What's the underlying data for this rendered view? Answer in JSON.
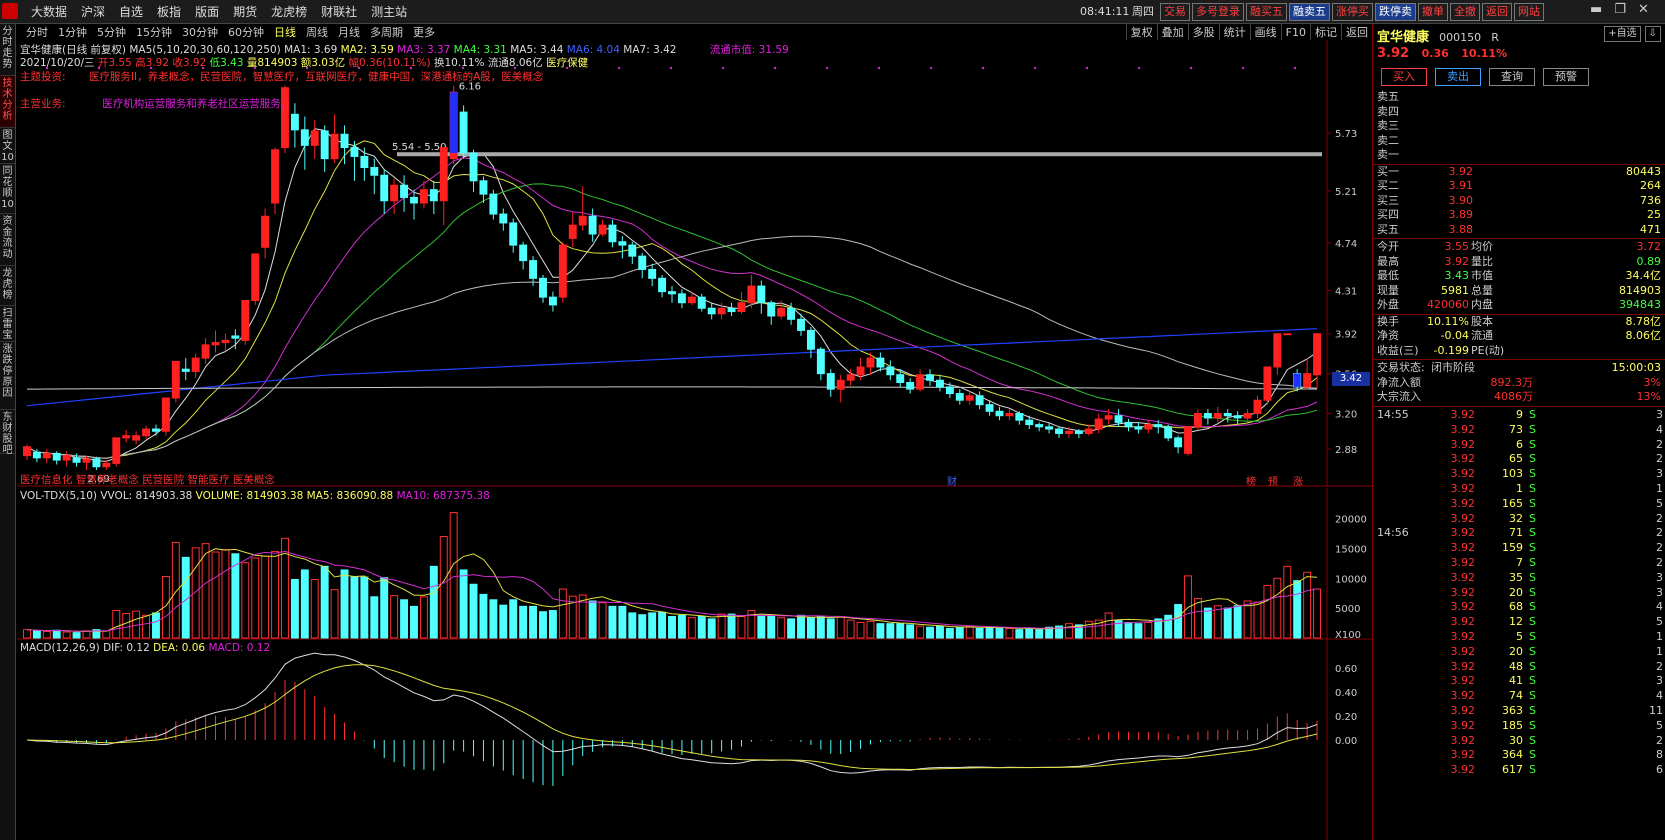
{
  "menu": [
    "大数据",
    "沪深",
    "自选",
    "板指",
    "版面",
    "期货",
    "龙虎榜",
    "财联社",
    "测主站"
  ],
  "clock": "08:41:11",
  "weekday": "周四",
  "topbtns": [
    "交易",
    "多号登录",
    "融买五",
    "融卖五",
    "涨停买",
    "跌停卖",
    "撤单",
    "全撤",
    "返回",
    "网站"
  ],
  "left_tabs": [
    "分时走势",
    "技术分析",
    "图文10",
    "同花顺10",
    "资金流动",
    "龙虎榜",
    "扫雷宝",
    "涨跌停原因",
    "东财股吧"
  ],
  "periods": [
    "分时",
    "1分钟",
    "5分钟",
    "15分钟",
    "30分钟",
    "60分钟",
    "日线",
    "周线",
    "月线",
    "多周期",
    "更多"
  ],
  "active_period": "日线",
  "rtools": [
    "复权",
    "叠加",
    "多股",
    "统计",
    "画线",
    "F10",
    "标记",
    "返回"
  ],
  "ma_legend": {
    "name": "宜华健康(日线 前复权)",
    "params": "MA5(5,10,20,30,60,120,250)",
    "ma1": "MA1: 3.69",
    "ma2": "MA2: 3.59",
    "ma3": "MA3: 3.37",
    "ma4": "MA4: 3.31",
    "ma5": "MA5: 3.44",
    "ma6": "MA6: 4.04",
    "ma7": "MA7: 3.42",
    "float_cap": "流通市值: 31.59"
  },
  "info_line": {
    "date": "2021/10/20/三",
    "open": "开3.55",
    "high": "高3.92",
    "close": "收3.92",
    "low": "低3.43",
    "vol": "量814903",
    "amt": "额3.03亿",
    "chg": "幅0.36(10.11%)",
    "turn": "换10.11%",
    "float": "流通8.06亿",
    "sector": "医疗保健"
  },
  "tags": {
    "label": "主题投资:",
    "text": "医疗服务II，养老概念，民营医院，智慧医疗，互联网医疗，健康中国，深港通标的A股，医美概念"
  },
  "biz": {
    "label": "主营业务:",
    "text": "医疗机构运营服务和养老社区运营服务。"
  },
  "bottom_tags": "医疗信息化 智慧养老概念 民营医院 智能医疗 医美概念",
  "annotations": {
    "max_label": "6.16",
    "min_label": "2.69",
    "range_label": "5.54 - 5.50",
    "markers": [
      "财",
      "榜",
      "预",
      "涨"
    ]
  },
  "y_axis": [
    "5.73",
    "5.21",
    "4.74",
    "4.31",
    "3.92",
    "3.56",
    "3.20",
    "2.88"
  ],
  "vol_y_axis": [
    "20000",
    "15000",
    "10000",
    "5000",
    "X100"
  ],
  "macd_y_axis": [
    "0.60",
    "0.40",
    "0.20",
    "0.00"
  ],
  "current_price_label": "3.42",
  "vol_legend": {
    "name": "VOL-TDX(5,10)",
    "vvol": "VVOL: 814903.38",
    "volume": "VOLUME: 814903.38",
    "ma5": "MA5: 836090.88",
    "ma10": "MA10: 687375.38"
  },
  "macd_legend": {
    "name": "MACD(12,26,9)",
    "dif": "DIF: 0.12",
    "dea": "DEA: 0.06",
    "macd": "MACD: 0.12"
  },
  "chart_data": {
    "type": "candlestick",
    "title": "宜华健康(日线 前复权)",
    "ylim": [
      2.6,
      6.3
    ],
    "candles": [
      [
        2.82,
        2.9,
        2.78,
        2.92
      ],
      [
        2.85,
        2.8,
        2.76,
        2.88
      ],
      [
        2.8,
        2.84,
        2.75,
        2.88
      ],
      [
        2.84,
        2.78,
        2.74,
        2.86
      ],
      [
        2.78,
        2.82,
        2.72,
        2.86
      ],
      [
        2.8,
        2.76,
        2.72,
        2.84
      ],
      [
        2.76,
        2.79,
        2.69,
        2.82
      ],
      [
        2.79,
        2.72,
        2.69,
        2.81
      ],
      [
        2.72,
        2.75,
        2.69,
        2.78
      ],
      [
        2.75,
        2.98,
        2.72,
        2.98
      ],
      [
        2.98,
        3.0,
        2.94,
        3.05
      ],
      [
        2.96,
        3.0,
        2.92,
        3.04
      ],
      [
        3.0,
        3.06,
        2.97,
        3.09
      ],
      [
        3.06,
        3.04,
        3.0,
        3.1
      ],
      [
        3.04,
        3.34,
        3.0,
        3.34
      ],
      [
        3.34,
        3.67,
        3.3,
        3.67
      ],
      [
        3.6,
        3.58,
        3.5,
        3.7
      ],
      [
        3.58,
        3.7,
        3.52,
        3.74
      ],
      [
        3.7,
        3.82,
        3.65,
        3.88
      ],
      [
        3.82,
        3.84,
        3.75,
        3.95
      ],
      [
        3.84,
        3.86,
        3.76,
        3.92
      ],
      [
        3.9,
        3.88,
        3.78,
        3.96
      ],
      [
        3.86,
        4.22,
        3.82,
        4.22
      ],
      [
        4.22,
        4.64,
        4.18,
        4.64
      ],
      [
        4.7,
        4.98,
        4.6,
        5.05
      ],
      [
        5.1,
        5.58,
        5.0,
        5.6
      ],
      [
        5.6,
        6.14,
        5.55,
        6.16
      ],
      [
        5.9,
        5.76,
        5.6,
        6.0
      ],
      [
        5.76,
        5.62,
        5.4,
        5.88
      ],
      [
        5.62,
        5.75,
        5.5,
        5.85
      ],
      [
        5.75,
        5.5,
        5.38,
        5.8
      ],
      [
        5.5,
        5.72,
        5.46,
        5.9
      ],
      [
        5.72,
        5.6,
        5.45,
        5.8
      ],
      [
        5.6,
        5.52,
        5.3,
        5.66
      ],
      [
        5.52,
        5.42,
        5.3,
        5.6
      ],
      [
        5.42,
        5.35,
        5.18,
        5.5
      ],
      [
        5.35,
        5.12,
        5.0,
        5.4
      ],
      [
        5.12,
        5.26,
        5.0,
        5.32
      ],
      [
        5.26,
        5.15,
        5.02,
        5.35
      ],
      [
        5.15,
        5.1,
        4.95,
        5.22
      ],
      [
        5.1,
        5.22,
        5.05,
        5.3
      ],
      [
        5.22,
        5.12,
        5.0,
        5.3
      ],
      [
        5.12,
        5.6,
        4.9,
        5.6
      ],
      [
        5.5,
        6.1,
        5.45,
        6.16
      ],
      [
        5.92,
        5.55,
        5.5,
        5.98
      ],
      [
        5.55,
        5.3,
        5.2,
        5.58
      ],
      [
        5.3,
        5.18,
        5.1,
        5.34
      ],
      [
        5.18,
        5.0,
        4.95,
        5.22
      ],
      [
        5.0,
        4.92,
        4.85,
        5.05
      ],
      [
        4.92,
        4.72,
        4.65,
        4.96
      ],
      [
        4.72,
        4.58,
        4.5,
        4.75
      ],
      [
        4.58,
        4.42,
        4.35,
        4.62
      ],
      [
        4.42,
        4.25,
        4.2,
        4.45
      ],
      [
        4.25,
        4.18,
        4.12,
        4.3
      ],
      [
        4.25,
        4.72,
        4.2,
        4.75
      ],
      [
        4.78,
        4.9,
        4.7,
        5.02
      ],
      [
        4.9,
        4.98,
        4.85,
        5.25
      ],
      [
        4.98,
        4.82,
        4.75,
        5.05
      ],
      [
        4.82,
        4.9,
        4.8,
        4.95
      ],
      [
        4.9,
        4.75,
        4.7,
        4.95
      ],
      [
        4.75,
        4.72,
        4.6,
        4.8
      ],
      [
        4.72,
        4.62,
        4.55,
        4.75
      ],
      [
        4.62,
        4.5,
        4.42,
        4.65
      ],
      [
        4.5,
        4.42,
        4.35,
        4.55
      ],
      [
        4.42,
        4.3,
        4.25,
        4.45
      ],
      [
        4.3,
        4.28,
        4.2,
        4.35
      ],
      [
        4.28,
        4.2,
        4.15,
        4.32
      ],
      [
        4.2,
        4.25,
        4.18,
        4.3
      ],
      [
        4.25,
        4.15,
        4.12,
        4.28
      ],
      [
        4.15,
        4.1,
        4.05,
        4.2
      ],
      [
        4.1,
        4.15,
        4.05,
        4.2
      ],
      [
        4.15,
        4.12,
        4.08,
        4.2
      ],
      [
        4.12,
        4.2,
        4.1,
        4.3
      ],
      [
        4.2,
        4.35,
        4.15,
        4.45
      ],
      [
        4.35,
        4.2,
        4.1,
        4.4
      ],
      [
        4.2,
        4.08,
        4.0,
        4.22
      ],
      [
        4.08,
        4.15,
        4.05,
        4.22
      ],
      [
        4.15,
        4.05,
        4.0,
        4.2
      ],
      [
        4.05,
        3.95,
        3.9,
        4.1
      ],
      [
        3.95,
        3.78,
        3.7,
        3.98
      ],
      [
        3.78,
        3.56,
        3.5,
        3.8
      ],
      [
        3.56,
        3.42,
        3.35,
        3.6
      ],
      [
        3.42,
        3.5,
        3.3,
        3.55
      ],
      [
        3.5,
        3.55,
        3.45,
        3.6
      ],
      [
        3.55,
        3.62,
        3.5,
        3.7
      ],
      [
        3.62,
        3.7,
        3.55,
        3.75
      ],
      [
        3.7,
        3.62,
        3.58,
        3.75
      ],
      [
        3.62,
        3.55,
        3.5,
        3.68
      ],
      [
        3.55,
        3.48,
        3.44,
        3.6
      ],
      [
        3.48,
        3.42,
        3.38,
        3.52
      ],
      [
        3.42,
        3.55,
        3.4,
        3.6
      ],
      [
        3.55,
        3.5,
        3.45,
        3.6
      ],
      [
        3.5,
        3.44,
        3.4,
        3.55
      ],
      [
        3.44,
        3.38,
        3.34,
        3.48
      ],
      [
        3.38,
        3.32,
        3.28,
        3.42
      ],
      [
        3.32,
        3.36,
        3.28,
        3.4
      ],
      [
        3.36,
        3.28,
        3.24,
        3.4
      ],
      [
        3.28,
        3.22,
        3.18,
        3.32
      ],
      [
        3.22,
        3.18,
        3.14,
        3.26
      ],
      [
        3.18,
        3.2,
        3.14,
        3.24
      ],
      [
        3.2,
        3.14,
        3.1,
        3.22
      ],
      [
        3.14,
        3.1,
        3.06,
        3.18
      ],
      [
        3.1,
        3.08,
        3.04,
        3.12
      ],
      [
        3.08,
        3.06,
        3.02,
        3.12
      ],
      [
        3.06,
        3.02,
        2.98,
        3.08
      ],
      [
        3.02,
        3.04,
        2.98,
        3.08
      ],
      [
        3.04,
        3.02,
        2.98,
        3.06
      ],
      [
        3.02,
        3.06,
        3.0,
        3.1
      ],
      [
        3.06,
        3.15,
        3.02,
        3.2
      ],
      [
        3.15,
        3.18,
        3.1,
        3.24
      ],
      [
        3.18,
        3.12,
        3.08,
        3.24
      ],
      [
        3.12,
        3.08,
        3.04,
        3.15
      ],
      [
        3.08,
        3.06,
        3.02,
        3.12
      ],
      [
        3.06,
        3.1,
        3.02,
        3.14
      ],
      [
        3.1,
        3.08,
        3.02,
        3.14
      ],
      [
        3.08,
        2.98,
        2.95,
        3.1
      ],
      [
        2.98,
        2.9,
        2.84,
        3.0
      ],
      [
        2.84,
        3.08,
        2.82,
        3.08
      ],
      [
        3.08,
        3.2,
        3.05,
        3.24
      ],
      [
        3.2,
        3.16,
        3.1,
        3.24
      ],
      [
        3.16,
        3.2,
        3.12,
        3.26
      ],
      [
        3.2,
        3.18,
        3.12,
        3.24
      ],
      [
        3.18,
        3.16,
        3.1,
        3.22
      ],
      [
        3.16,
        3.2,
        3.12,
        3.24
      ],
      [
        3.2,
        3.32,
        3.16,
        3.36
      ],
      [
        3.32,
        3.62,
        3.28,
        3.62
      ],
      [
        3.62,
        3.92,
        3.55,
        3.92
      ],
      [
        3.92,
        3.92,
        3.92,
        3.92
      ],
      [
        3.56,
        3.44,
        3.4,
        3.6
      ],
      [
        3.44,
        3.56,
        3.42,
        3.7
      ],
      [
        3.55,
        3.92,
        3.43,
        3.92
      ]
    ],
    "volume": [
      14,
      12,
      11,
      13,
      10,
      9,
      12,
      14,
      12,
      46,
      41,
      45,
      38,
      42,
      103,
      160,
      135,
      151,
      158,
      144,
      148,
      141,
      126,
      134,
      137,
      145,
      167,
      98,
      114,
      98,
      120,
      81,
      114,
      102,
      102,
      69,
      101,
      71,
      64,
      53,
      69,
      120,
      170,
      210,
      114,
      90,
      73,
      64,
      55,
      64,
      53,
      53,
      44,
      46,
      82,
      70,
      72,
      62,
      59,
      53,
      53,
      42,
      39,
      42,
      43,
      36,
      38,
      34,
      36,
      32,
      40,
      40,
      36,
      46,
      38,
      36,
      34,
      32,
      38,
      34,
      36,
      32,
      36,
      30,
      26,
      28,
      24,
      24,
      24,
      22,
      20,
      18,
      20,
      16,
      18,
      20,
      16,
      18,
      16,
      16,
      14,
      16,
      14,
      18,
      20,
      24,
      22,
      28,
      30,
      42,
      30,
      26,
      24,
      26,
      32,
      38,
      56,
      104,
      66,
      50,
      54,
      50,
      54,
      62,
      60,
      88,
      100,
      120,
      96,
      110,
      82
    ],
    "macd": {
      "dif_peak": 0.66,
      "dea_peak": 0.62,
      "last_dif": 0.12,
      "last_dea": 0.06,
      "last_macd": 0.12
    }
  },
  "right_panel": {
    "name": "宜华健康",
    "code": "000150",
    "suffix": "R",
    "btns": [
      "+自选",
      "⇩"
    ],
    "price": "3.92",
    "change": "0.36",
    "pct": "10.11%",
    "actions": [
      "买入",
      "卖出",
      "查询",
      "预警"
    ],
    "asks": [
      {
        "l": "卖五",
        "p": "",
        "v": ""
      },
      {
        "l": "卖四",
        "p": "",
        "v": ""
      },
      {
        "l": "卖三",
        "p": "",
        "v": ""
      },
      {
        "l": "卖二",
        "p": "",
        "v": ""
      },
      {
        "l": "卖一",
        "p": "",
        "v": ""
      }
    ],
    "bids": [
      {
        "l": "买一",
        "p": "3.92",
        "v": "80443"
      },
      {
        "l": "买二",
        "p": "3.91",
        "v": "264"
      },
      {
        "l": "买三",
        "p": "3.90",
        "v": "736"
      },
      {
        "l": "买四",
        "p": "3.89",
        "v": "25"
      },
      {
        "l": "买五",
        "p": "3.88",
        "v": "471"
      }
    ],
    "stats": [
      {
        "l1": "今开",
        "v1": "3.55",
        "l2": "均价",
        "v2": "3.72",
        "c1": "#ff3030",
        "c2": "#ff3030"
      },
      {
        "l1": "最高",
        "v1": "3.92",
        "l2": "量比",
        "v2": "0.89",
        "c1": "#ff3030",
        "c2": "#40ff40"
      },
      {
        "l1": "最低",
        "v1": "3.43",
        "l2": "市值",
        "v2": "34.4亿",
        "c1": "#40ff40",
        "c2": "#ffff60"
      },
      {
        "l1": "现量",
        "v1": "5981",
        "l2": "总量",
        "v2": "814903",
        "c1": "#ffff60",
        "c2": "#ffff60"
      },
      {
        "l1": "外盘",
        "v1": "420060",
        "l2": "内盘",
        "v2": "394843",
        "c1": "#ff3030",
        "c2": "#40ff40"
      },
      {
        "l1": "换手",
        "v1": "10.11%",
        "l2": "股本",
        "v2": "8.78亿",
        "c1": "#ffff60",
        "c2": "#ffff60"
      },
      {
        "l1": "净资",
        "v1": "-0.04",
        "l2": "流通",
        "v2": "8.06亿",
        "c1": "#ffff60",
        "c2": "#ffff60"
      },
      {
        "l1": "收益(三)",
        "v1": "-0.199",
        "l2": "PE(动)",
        "v2": "",
        "c1": "#ffff60",
        "c2": "#ffff60"
      }
    ],
    "trade_status_label": "交易状态:",
    "trade_status": "闭市阶段",
    "trade_time": "15:00:03",
    "net_inflow_label": "净流入额",
    "net_inflow": "892.3万",
    "net_inflow_pct": "3%",
    "block_label": "大宗流入",
    "block_inflow": "4086万",
    "block_pct": "13%",
    "ticks": [
      {
        "t": "14:55",
        "p": "3.92",
        "v": "9",
        "s": "S",
        "n": "3"
      },
      {
        "t": "",
        "p": "3.92",
        "v": "73",
        "s": "S",
        "n": "4"
      },
      {
        "t": "",
        "p": "3.92",
        "v": "6",
        "s": "S",
        "n": "2"
      },
      {
        "t": "",
        "p": "3.92",
        "v": "65",
        "s": "S",
        "n": "2"
      },
      {
        "t": "",
        "p": "3.92",
        "v": "103",
        "s": "S",
        "n": "3"
      },
      {
        "t": "",
        "p": "3.92",
        "v": "1",
        "s": "S",
        "n": "1"
      },
      {
        "t": "",
        "p": "3.92",
        "v": "165",
        "s": "S",
        "n": "5"
      },
      {
        "t": "",
        "p": "3.92",
        "v": "32",
        "s": "S",
        "n": "2"
      },
      {
        "t": "14:56",
        "p": "3.92",
        "v": "71",
        "s": "S",
        "n": "2"
      },
      {
        "t": "",
        "p": "3.92",
        "v": "159",
        "s": "S",
        "n": "2"
      },
      {
        "t": "",
        "p": "3.92",
        "v": "7",
        "s": "S",
        "n": "2"
      },
      {
        "t": "",
        "p": "3.92",
        "v": "35",
        "s": "S",
        "n": "3"
      },
      {
        "t": "",
        "p": "3.92",
        "v": "20",
        "s": "S",
        "n": "3"
      },
      {
        "t": "",
        "p": "3.92",
        "v": "68",
        "s": "S",
        "n": "4"
      },
      {
        "t": "",
        "p": "3.92",
        "v": "12",
        "s": "S",
        "n": "5"
      },
      {
        "t": "",
        "p": "3.92",
        "v": "5",
        "s": "S",
        "n": "1"
      },
      {
        "t": "",
        "p": "3.92",
        "v": "20",
        "s": "S",
        "n": "1"
      },
      {
        "t": "",
        "p": "3.92",
        "v": "48",
        "s": "S",
        "n": "2"
      },
      {
        "t": "",
        "p": "3.92",
        "v": "41",
        "s": "S",
        "n": "3"
      },
      {
        "t": "",
        "p": "3.92",
        "v": "74",
        "s": "S",
        "n": "4"
      },
      {
        "t": "",
        "p": "3.92",
        "v": "363",
        "s": "S",
        "n": "11"
      },
      {
        "t": "",
        "p": "3.92",
        "v": "185",
        "s": "S",
        "n": "5"
      },
      {
        "t": "",
        "p": "3.92",
        "v": "30",
        "s": "S",
        "n": "2"
      },
      {
        "t": "",
        "p": "3.92",
        "v": "364",
        "s": "S",
        "n": "8"
      },
      {
        "t": "",
        "p": "3.92",
        "v": "617",
        "s": "S",
        "n": "6"
      }
    ]
  }
}
